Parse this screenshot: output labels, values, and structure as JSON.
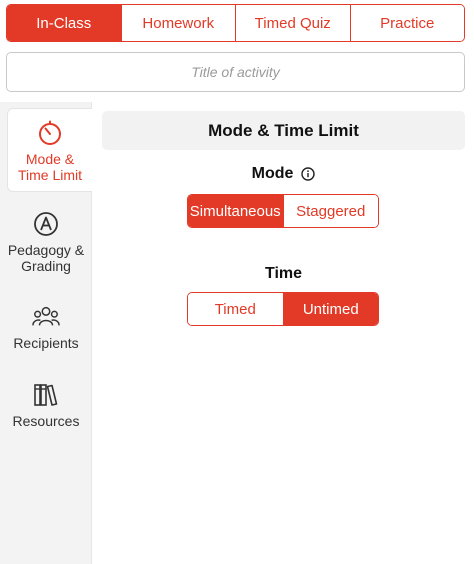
{
  "activity_types": [
    {
      "label": "In-Class",
      "active": true
    },
    {
      "label": "Homework",
      "active": false
    },
    {
      "label": "Timed Quiz",
      "active": false
    },
    {
      "label": "Practice",
      "active": false
    }
  ],
  "title_field": {
    "placeholder": "Title of activity",
    "value": ""
  },
  "sidebar": {
    "items": [
      {
        "label": "Mode & Time Limit",
        "icon": "timer-icon",
        "active": true
      },
      {
        "label": "Pedagogy & Grading",
        "icon": "pedagogy-icon",
        "active": false
      },
      {
        "label": "Recipients",
        "icon": "people-icon",
        "active": false
      },
      {
        "label": "Resources",
        "icon": "books-icon",
        "active": false
      }
    ]
  },
  "main": {
    "section_title": "Mode & Time Limit",
    "mode": {
      "label": "Mode",
      "info_icon": "info-icon",
      "options": [
        "Simultaneous",
        "Staggered"
      ],
      "selected": "Simultaneous"
    },
    "time": {
      "label": "Time",
      "options": [
        "Timed",
        "Untimed"
      ],
      "selected": "Untimed"
    }
  },
  "colors": {
    "accent": "#e23a26",
    "sidebar_bg": "#f3f3f3",
    "header_bg": "#f2f2f2"
  }
}
